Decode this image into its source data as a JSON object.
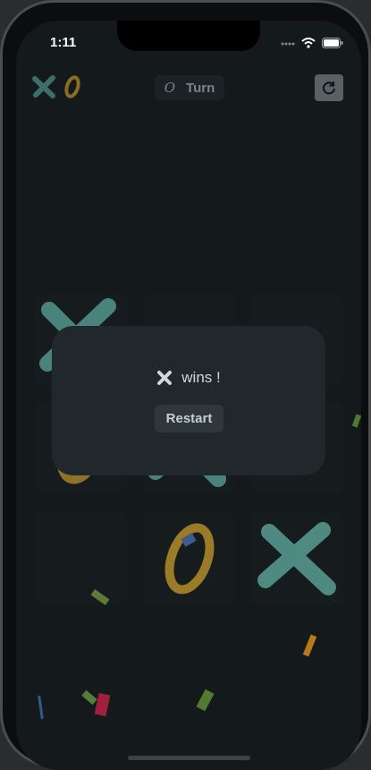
{
  "status_bar": {
    "time": "1:11",
    "icons": [
      "signal-icon",
      "wifi-icon",
      "battery-icon"
    ]
  },
  "header": {
    "brand_symbols": [
      "X",
      "O"
    ],
    "turn": {
      "symbol": "O",
      "label": "Turn"
    },
    "reset_icon": "refresh-icon"
  },
  "board": {
    "cells": [
      "X",
      "",
      "",
      "O",
      "X",
      "",
      "",
      "O",
      "X"
    ]
  },
  "result": {
    "winner_symbol": "X",
    "message": "wins !",
    "restart_label": "Restart"
  },
  "colors": {
    "x": "#4e8c84",
    "o": "#9c7b28",
    "background": "#14191b",
    "overlay": "#20282c"
  }
}
